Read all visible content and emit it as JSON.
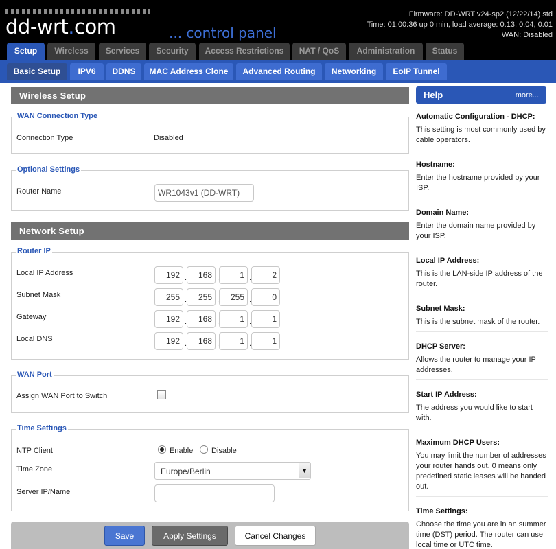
{
  "header": {
    "logo_main": "dd-wrt",
    "logo_suffix": "com",
    "tagline": "... control panel",
    "firmware": "Firmware: DD-WRT v24-sp2 (12/22/14) std",
    "uptime": "Time: 01:00:36 up 0 min, load average: 0.13, 0.04, 0.01",
    "wan_status": "WAN: Disabled"
  },
  "main_tabs": [
    "Setup",
    "Wireless",
    "Services",
    "Security",
    "Access Restrictions",
    "NAT / QoS",
    "Administration",
    "Status"
  ],
  "sub_tabs": [
    "Basic Setup",
    "IPV6",
    "DDNS",
    "MAC Address Clone",
    "Advanced Routing",
    "Networking",
    "EoIP Tunnel"
  ],
  "wireless_setup": {
    "title": "Wireless Setup",
    "wan_connection": {
      "legend": "WAN Connection Type",
      "label": "Connection Type",
      "value": "Disabled"
    },
    "optional": {
      "legend": "Optional Settings",
      "router_name_label": "Router Name",
      "router_name_value": "WR1043v1 (DD-WRT)"
    }
  },
  "network_setup": {
    "title": "Network Setup",
    "router_ip": {
      "legend": "Router IP",
      "local_ip": {
        "label": "Local IP Address",
        "octets": [
          "192",
          "168",
          "1",
          "2"
        ]
      },
      "subnet": {
        "label": "Subnet Mask",
        "octets": [
          "255",
          "255",
          "255",
          "0"
        ]
      },
      "gateway": {
        "label": "Gateway",
        "octets": [
          "192",
          "168",
          "1",
          "1"
        ]
      },
      "dns": {
        "label": "Local DNS",
        "octets": [
          "192",
          "168",
          "1",
          "1"
        ]
      },
      "separator": "."
    },
    "wan_port": {
      "legend": "WAN Port",
      "label": "Assign WAN Port to Switch",
      "checked": false
    },
    "time": {
      "legend": "Time Settings",
      "ntp_label": "NTP Client",
      "enable_label": "Enable",
      "disable_label": "Disable",
      "ntp_selected": "Enable",
      "timezone_label": "Time Zone",
      "timezone_value": "Europe/Berlin",
      "server_label": "Server IP/Name",
      "server_value": ""
    }
  },
  "buttons": {
    "save": "Save",
    "apply": "Apply Settings",
    "cancel": "Cancel Changes"
  },
  "help": {
    "title": "Help",
    "more": "more...",
    "items": [
      {
        "heading": "Automatic Configuration - DHCP:",
        "text": "This setting is most commonly used by cable operators."
      },
      {
        "heading": "Hostname:",
        "text": "Enter the hostname provided by your ISP."
      },
      {
        "heading": "Domain Name:",
        "text": "Enter the domain name provided by your ISP."
      },
      {
        "heading": "Local IP Address:",
        "text": "This is the LAN-side IP address of the router."
      },
      {
        "heading": "Subnet Mask:",
        "text": "This is the subnet mask of the router."
      },
      {
        "heading": "DHCP Server:",
        "text": "Allows the router to manage your IP addresses."
      },
      {
        "heading": "Start IP Address:",
        "text": "The address you would like to start with."
      },
      {
        "heading": "Maximum DHCP Users:",
        "text": "You may limit the number of addresses your router hands out. 0 means only predefined static leases will be handed out."
      },
      {
        "heading": "Time Settings:",
        "text": "Choose the time you are in an summer time (DST) period. The router can use local time or UTC time."
      }
    ]
  },
  "colors": {
    "accent_blue": "#2a57b6",
    "section_gray": "#727272",
    "header_black": "#000000"
  }
}
